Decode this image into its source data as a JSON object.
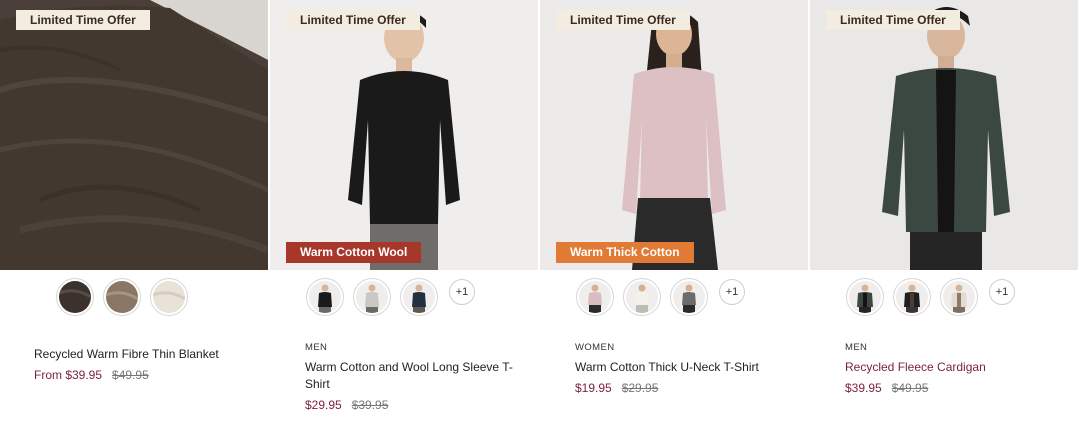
{
  "products": [
    {
      "offer_label": "Limited Time Offer",
      "feature_label": "",
      "swatches": [
        "dark-brown",
        "taupe",
        "ivory"
      ],
      "more_colors": "",
      "gender": "",
      "title": "Recycled Warm Fibre Thin Blanket",
      "price_now": "From $39.95",
      "price_was": "$49.95"
    },
    {
      "offer_label": "Limited Time Offer",
      "feature_label": "Warm Cotton Wool",
      "feature_color": "#a8372b",
      "swatches": [
        "black",
        "light-grey",
        "navy"
      ],
      "more_colors": "+1",
      "gender": "MEN",
      "title": "Warm Cotton and Wool Long Sleeve T-Shirt",
      "price_now": "$29.95",
      "price_was": "$39.95"
    },
    {
      "offer_label": "Limited Time Offer",
      "feature_label": "Warm Thick Cotton",
      "feature_color": "#e07a35",
      "swatches": [
        "pink",
        "off-white",
        "charcoal"
      ],
      "more_colors": "+1",
      "gender": "WOMEN",
      "title": "Warm Cotton Thick U-Neck T-Shirt",
      "price_now": "$19.95",
      "price_was": "$29.95"
    },
    {
      "offer_label": "Limited Time Offer",
      "feature_label": "",
      "swatches": [
        "dark-green",
        "black",
        "beige"
      ],
      "more_colors": "+1",
      "gender": "MEN",
      "title": "Recycled Fleece Cardigan",
      "price_now": "$39.95",
      "price_was": "$49.95"
    }
  ],
  "colors": {
    "price_accent": "#7c1f3a",
    "offer_bg": "#f3ece1"
  }
}
